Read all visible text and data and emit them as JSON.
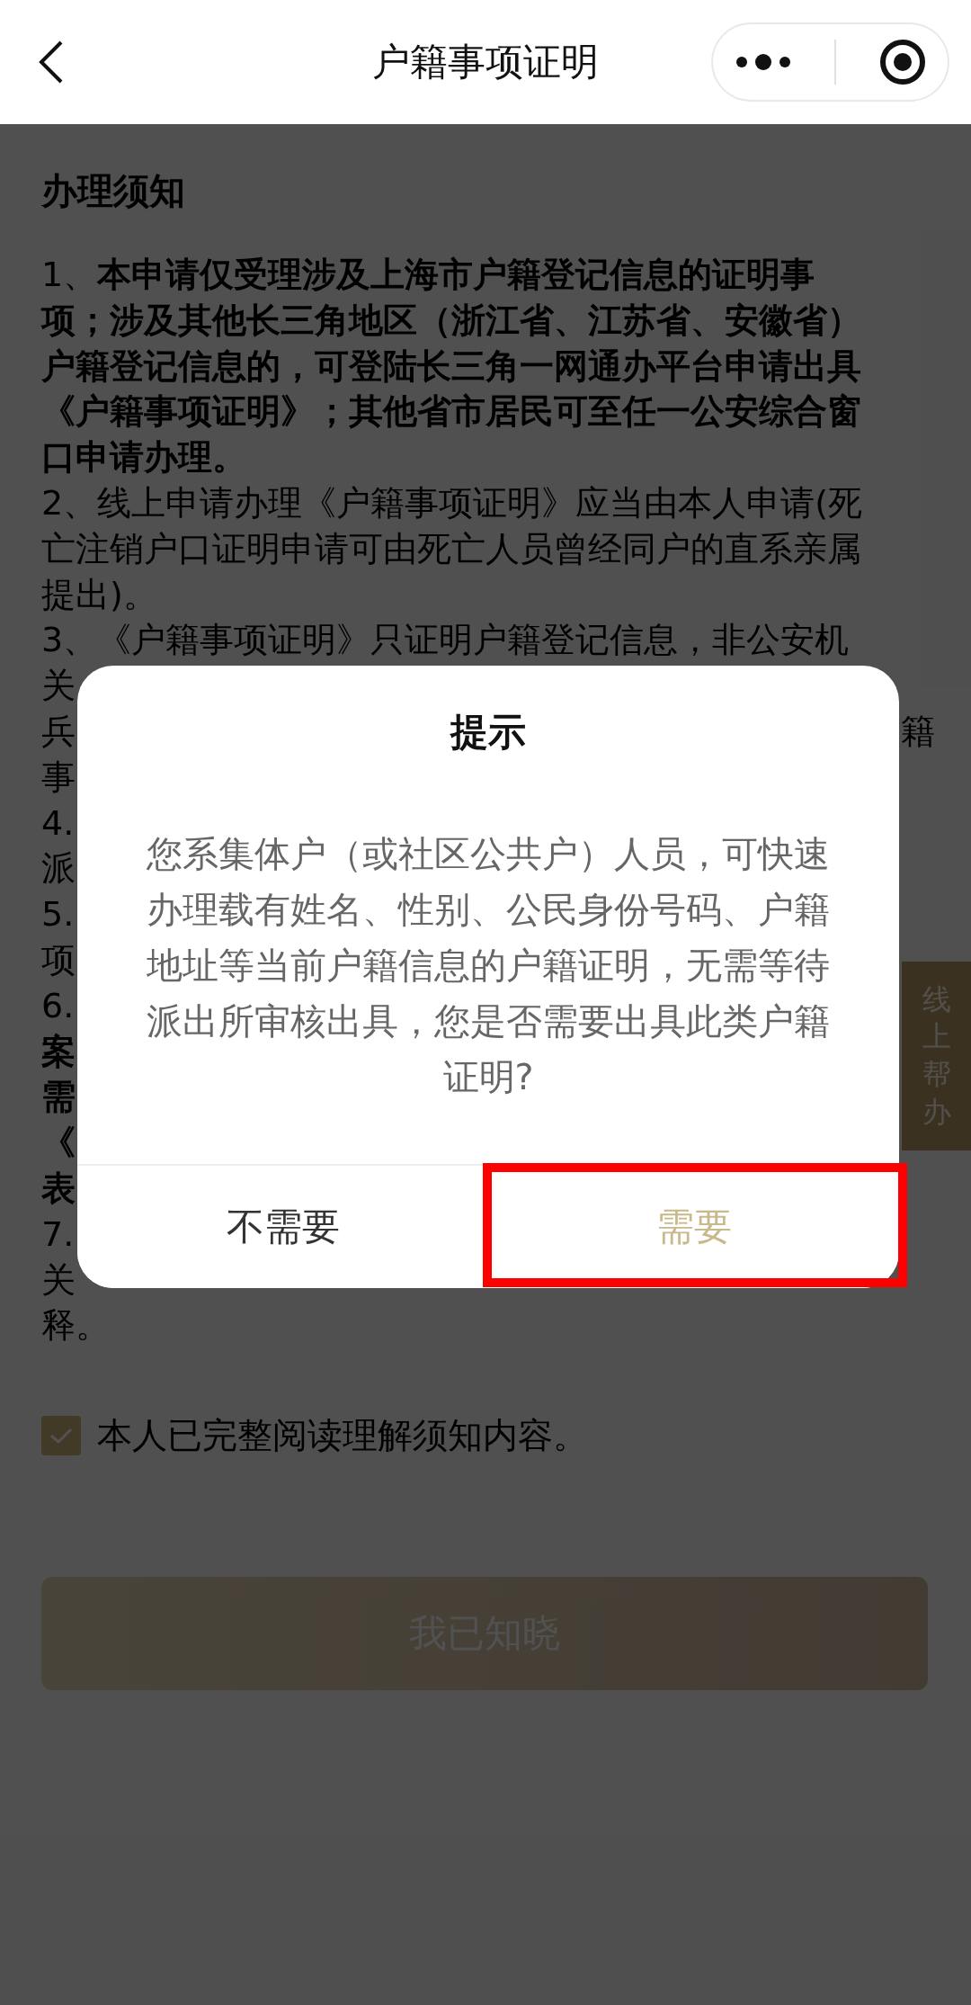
{
  "nav": {
    "title": "户籍事项证明"
  },
  "notice": {
    "title": "办理须知",
    "lines": [
      {
        "text": "1、**本申请仅受理涉及上海市户籍登记信息的证明事**",
        "bold": false
      },
      {
        "text": "项；涉及其他长三角地区（浙江省、江苏省、安徽省）",
        "bold": true
      },
      {
        "text": "户籍登记信息的，可登陆长三角一网通办平台申请出具",
        "bold": true
      },
      {
        "text": "《户籍事项证明》；其他省市居民可至任一公安综合窗",
        "bold": true
      },
      {
        "text": "口申请办理。",
        "bold": true
      },
      {
        "text": "2、线上申请办理《户籍事项证明》应当由本人申请(死",
        "bold": false
      },
      {
        "text": "亡注销户口证明申请可由死亡人员曾经同户的直系亲属",
        "bold": false
      },
      {
        "text": "提出)。",
        "bold": false
      },
      {
        "text": "3、《户籍事项证明》只证明户籍登记信息，非公安机",
        "bold": false
      },
      {
        "text": "关",
        "bold": false
      },
      {
        "text": "兵",
        "right": "籍",
        "bold": false
      },
      {
        "text": "事",
        "bold": false
      },
      {
        "text": "4.",
        "bold": false
      },
      {
        "text": "派",
        "bold": false
      },
      {
        "text": "5.",
        "bold": false
      },
      {
        "text": "项",
        "bold": false
      },
      {
        "text": "6.",
        "bold": false
      },
      {
        "text": "案",
        "bold": true
      },
      {
        "text": "需",
        "bold": true
      },
      {
        "text": "《",
        "bold": true
      },
      {
        "text": "表",
        "bold": true
      },
      {
        "text": "7.",
        "bold": false
      },
      {
        "text": "关",
        "bold": false
      },
      {
        "text": "释。",
        "bold": false
      }
    ]
  },
  "agreement": {
    "label": "本人已完整阅读理解须知内容。",
    "checked": true
  },
  "confirm_button": "我已知晓",
  "side_tab": "线上帮办",
  "dialog": {
    "title": "提示",
    "message": "您系集体户（或社区公共户）人员，可快速办理载有姓名、性别、公民身份号码、户籍地址等当前户籍信息的户籍证明，无需等待派出所审核出具，您是否需要出具此类户籍证明?",
    "buttons": [
      {
        "label": "不需要",
        "kind": "secondary"
      },
      {
        "label": "需要",
        "kind": "primary"
      }
    ]
  }
}
